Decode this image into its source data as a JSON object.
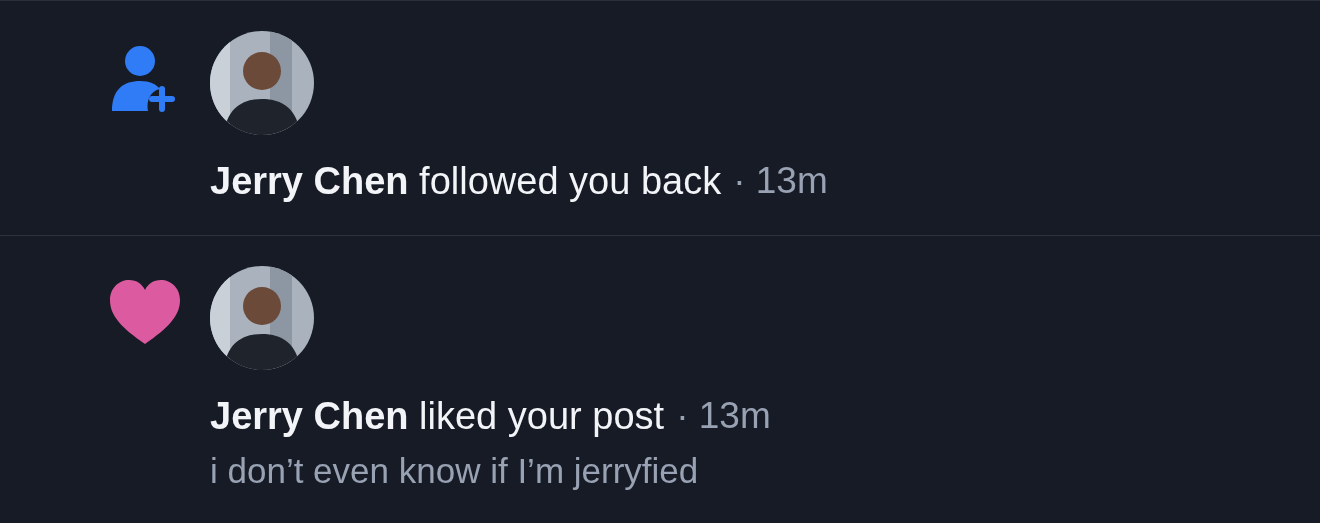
{
  "notifications": [
    {
      "kind": "follow",
      "text": "**Jerry Chen** followed you back",
      "time": "· 13m"
    },
    {
      "kind": "like",
      "text": "**Jerry Chen** liked your post",
      "time": "· 13m",
      "post_text": "i don’t even know if I’m jerryfied"
    }
  ]
}
